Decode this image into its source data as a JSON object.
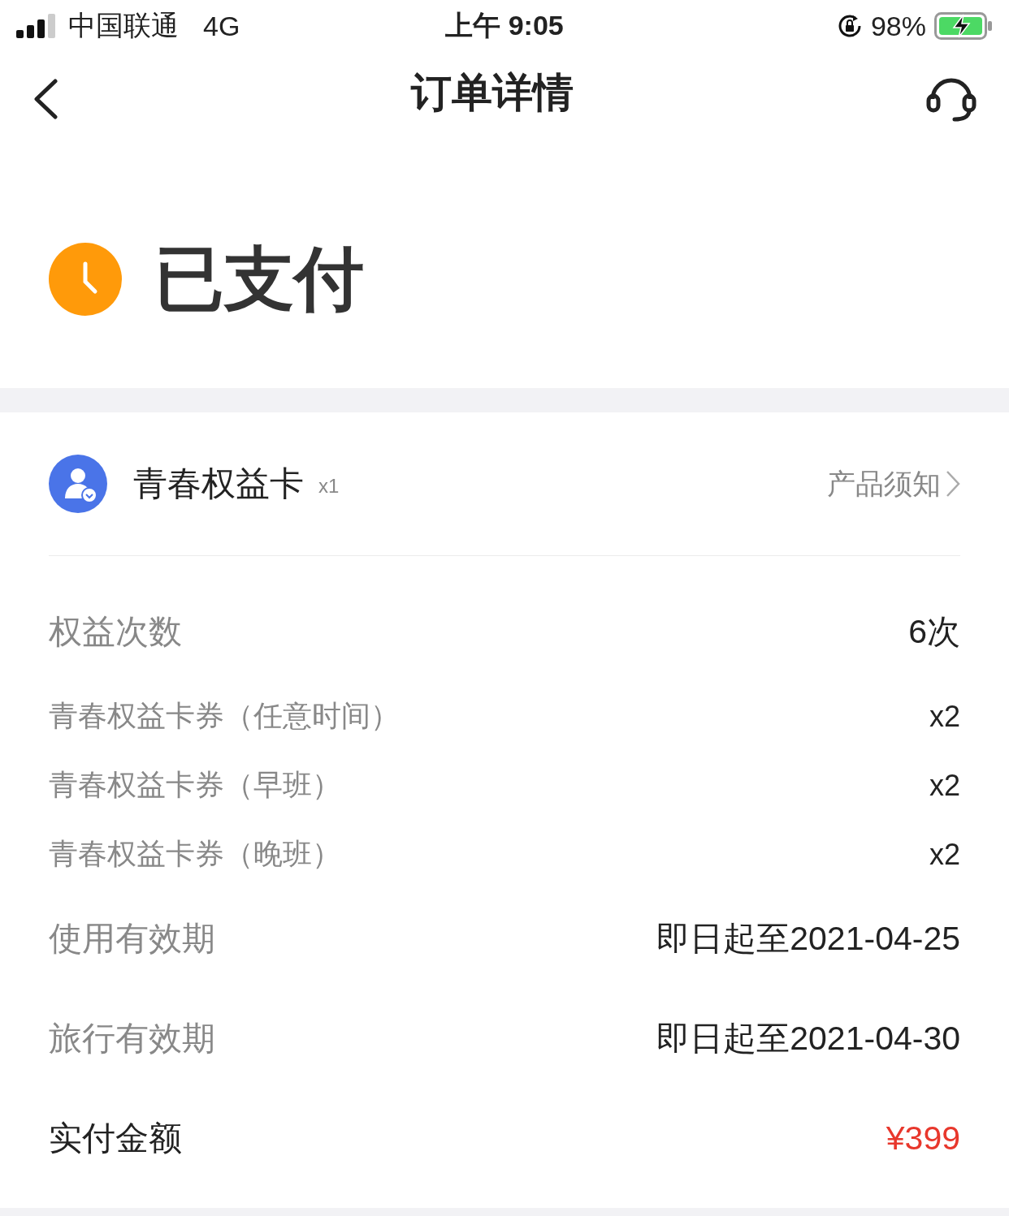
{
  "status_bar": {
    "carrier": "中国联通",
    "network": "4G",
    "time": "上午 9:05",
    "battery": "98%"
  },
  "nav": {
    "title": "订单详情"
  },
  "order_status": {
    "label": "已支付"
  },
  "product": {
    "name": "青春权益卡",
    "quantity": "x1",
    "notice_link": "产品须知"
  },
  "rows": [
    {
      "kind": "main",
      "label": "权益次数",
      "value": "6次"
    },
    {
      "kind": "sub",
      "label": "青春权益卡券（任意时间）",
      "value": "x2"
    },
    {
      "kind": "sub",
      "label": "青春权益卡券（早班）",
      "value": "x2"
    },
    {
      "kind": "sub",
      "label": "青春权益卡券（晚班）",
      "value": "x2"
    },
    {
      "kind": "main",
      "label": "使用有效期",
      "value": "即日起至2021-04-25"
    },
    {
      "kind": "main",
      "label": "旅行有效期",
      "value": "即日起至2021-04-30"
    },
    {
      "kind": "total",
      "label": "实付金额",
      "value": "¥399"
    }
  ]
}
